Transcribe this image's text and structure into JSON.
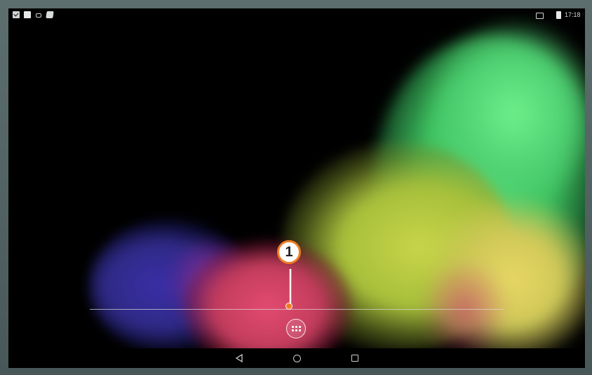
{
  "status_bar": {
    "left_icons": [
      "checkbox-notification-icon",
      "square-notification-icon",
      "usb-icon",
      "note-icon"
    ],
    "right_icons": [
      "cast-icon",
      "battery-icon"
    ],
    "time": "17:18"
  },
  "home_screen": {
    "app_drawer_icon": "app-drawer-grid-icon"
  },
  "callout": {
    "number": "1",
    "color": "#f07c22"
  },
  "navigation_bar": {
    "buttons": [
      "back-icon",
      "home-icon",
      "recents-icon"
    ]
  }
}
